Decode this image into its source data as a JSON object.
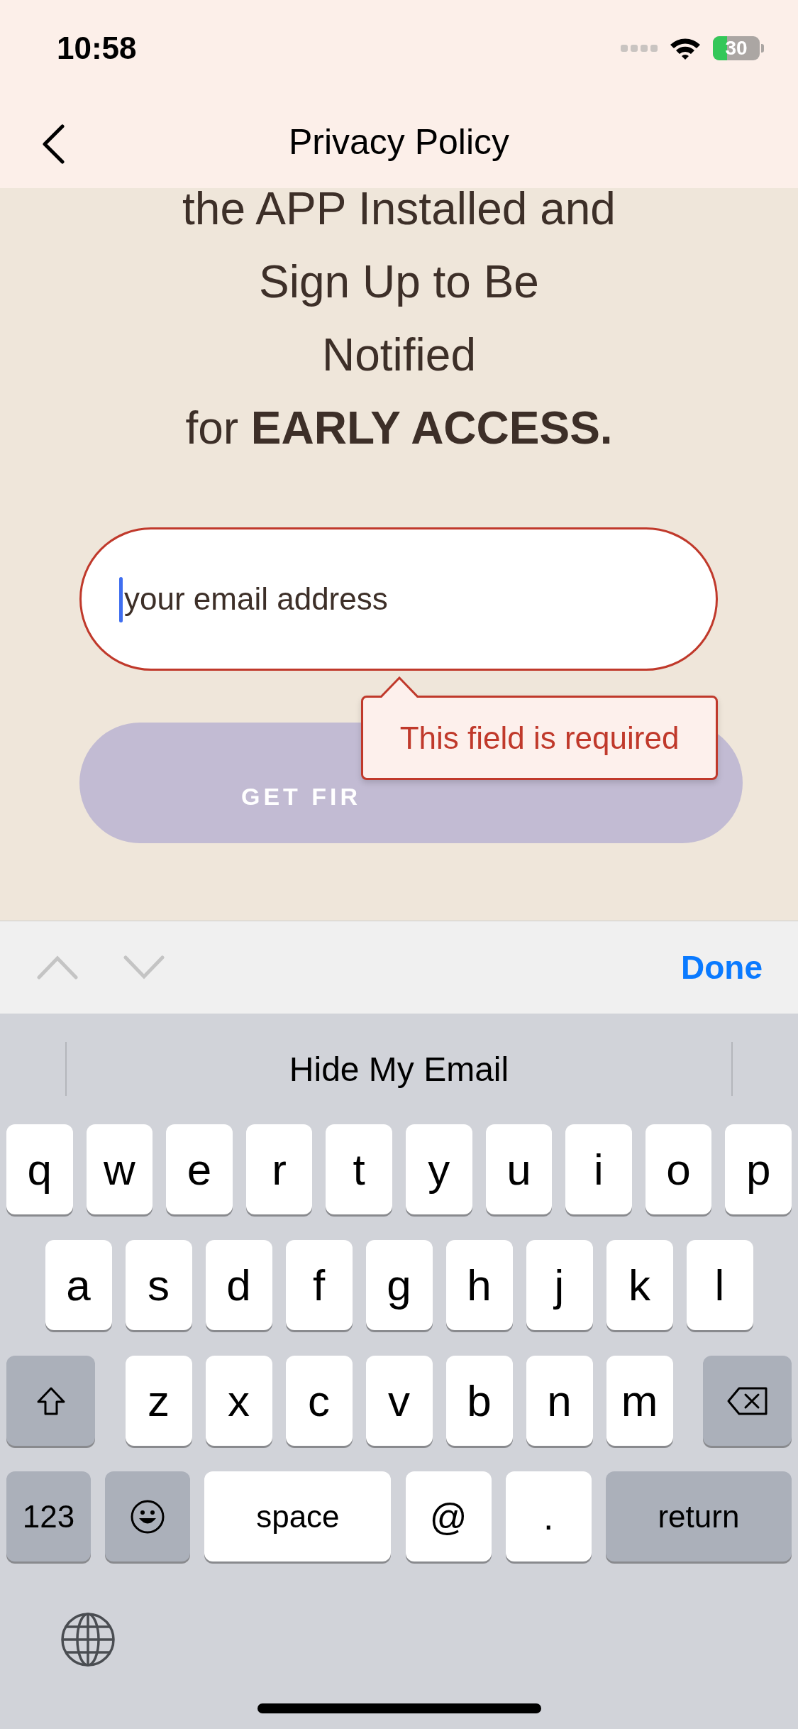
{
  "status_bar": {
    "time": "10:58",
    "battery": "30"
  },
  "nav": {
    "title": "Privacy Policy"
  },
  "headline": [
    "the APP Installed and",
    "Sign Up to Be",
    "Notified",
    "for **EARLY ACCESS.**"
  ],
  "email_field": {
    "placeholder": "your email address",
    "invalid": true
  },
  "error_tooltip": "This field is required",
  "submit_button": {
    "label": "GET FIR",
    "disabled": true
  },
  "accessory_bar": {
    "done": "Done"
  },
  "keyboard": {
    "suggestion": "Hide My Email",
    "rows": [
      [
        "q",
        "w",
        "e",
        "r",
        "t",
        "y",
        "u",
        "i",
        "o",
        "p"
      ],
      [
        "a",
        "s",
        "d",
        "f",
        "g",
        "h",
        "j",
        "k",
        "l"
      ],
      [
        "z",
        "x",
        "c",
        "v",
        "b",
        "n",
        "m"
      ]
    ],
    "bottom": {
      "numbers": "123",
      "space": "space",
      "at": "@",
      "period": ".",
      "return": "return"
    }
  }
}
